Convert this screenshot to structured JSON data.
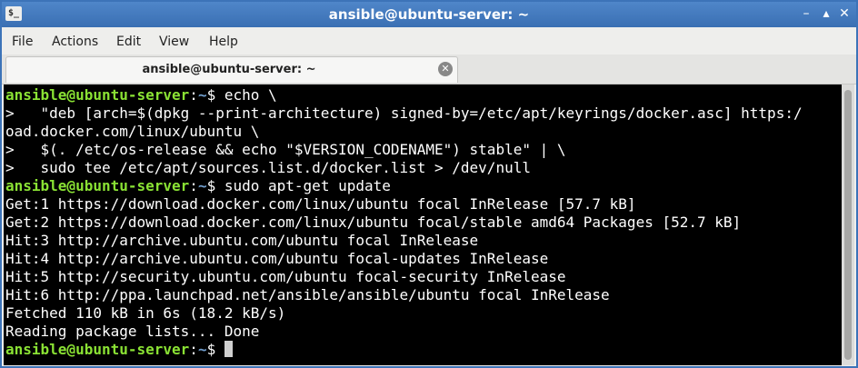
{
  "window": {
    "title": "ansible@ubuntu-server: ~",
    "icon_text": "$_"
  },
  "menu": [
    "File",
    "Actions",
    "Edit",
    "View",
    "Help"
  ],
  "tab": {
    "label": "ansible@ubuntu-server: ~"
  },
  "terminal": {
    "lines": [
      {
        "prompt": "ansible@ubuntu-server",
        "path": "~",
        "cmd": " echo \\"
      },
      {
        "text": ">   \"deb [arch=$(dpkg --print-architecture) signed-by=/etc/apt/keyrings/docker.asc] https:/"
      },
      {
        "text": "oad.docker.com/linux/ubuntu \\"
      },
      {
        "text": ">   $(. /etc/os-release && echo \"$VERSION_CODENAME\") stable\" | \\"
      },
      {
        "text": ">   sudo tee /etc/apt/sources.list.d/docker.list > /dev/null"
      },
      {
        "prompt": "ansible@ubuntu-server",
        "path": "~",
        "cmd": " sudo apt-get update"
      },
      {
        "text": "Get:1 https://download.docker.com/linux/ubuntu focal InRelease [57.7 kB]"
      },
      {
        "text": "Get:2 https://download.docker.com/linux/ubuntu focal/stable amd64 Packages [52.7 kB]"
      },
      {
        "text": "Hit:3 http://archive.ubuntu.com/ubuntu focal InRelease"
      },
      {
        "text": "Hit:4 http://archive.ubuntu.com/ubuntu focal-updates InRelease"
      },
      {
        "text": "Hit:5 http://security.ubuntu.com/ubuntu focal-security InRelease"
      },
      {
        "text": "Hit:6 http://ppa.launchpad.net/ansible/ansible/ubuntu focal InRelease"
      },
      {
        "text": "Fetched 110 kB in 6s (18.2 kB/s)"
      },
      {
        "text": "Reading package lists... Done"
      },
      {
        "prompt": "ansible@ubuntu-server",
        "path": "~",
        "cmd": " ",
        "cursor": true
      }
    ]
  },
  "colors": {
    "titlebar": "#3a6fb3",
    "prompt": "#8ae234",
    "path": "#729fcf",
    "terminal_bg": "#000000"
  },
  "icons": {
    "close": "close-icon",
    "minimize": "minimize-icon",
    "maximize": "maximize-icon",
    "tab_close": "tab-close-icon"
  }
}
